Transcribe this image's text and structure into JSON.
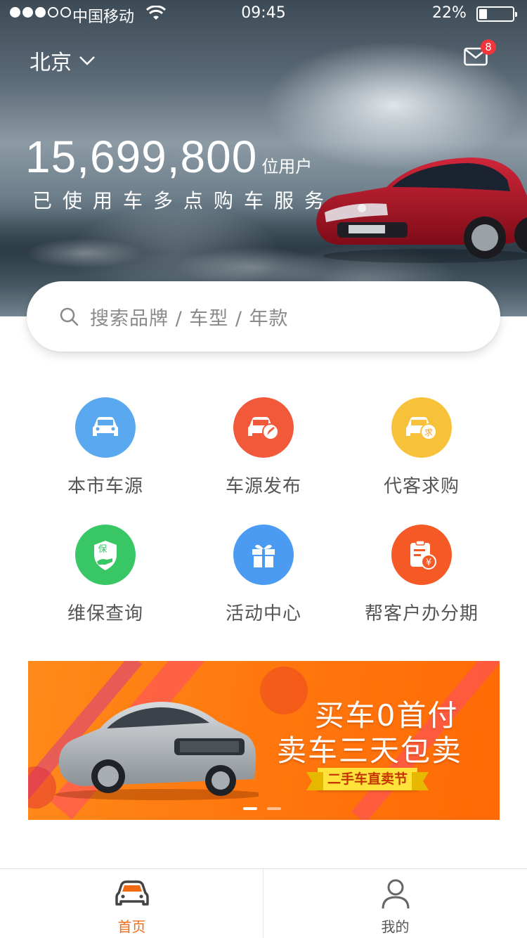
{
  "status_bar": {
    "carrier": "中国移动",
    "time": "09:45",
    "battery": "22%",
    "battery_level": 0.22,
    "signal_bars_filled": 3,
    "signal_bars_total": 5
  },
  "header": {
    "city": "北京",
    "mail_badge": "8"
  },
  "hero": {
    "user_count": "15,699,800",
    "user_unit": "位用户",
    "slogan": "已使用车多点购车服务"
  },
  "search": {
    "placeholder": "搜索品牌 / 车型 / 年款"
  },
  "features": [
    {
      "label": "本市车源",
      "icon": "car-icon",
      "color": "#5aa9f0"
    },
    {
      "label": "车源发布",
      "icon": "car-edit-icon",
      "color": "#f2583a"
    },
    {
      "label": "代客求购",
      "icon": "car-request-icon",
      "color": "#f7c23a"
    },
    {
      "label": "维保查询",
      "icon": "shield-hand-icon",
      "color": "#39c766"
    },
    {
      "label": "活动中心",
      "icon": "gift-icon",
      "color": "#4c9bf2"
    },
    {
      "label": "帮客户办分期",
      "icon": "bill-yen-icon",
      "color": "#f55a26"
    }
  ],
  "banner": {
    "line1": "买车0首付",
    "line2": "卖车三天包卖",
    "ribbon": "二手车直卖节",
    "total_slides": 2,
    "active_slide": 1
  },
  "tabbar": {
    "tabs": [
      {
        "label": "首页",
        "icon": "car-front-icon",
        "active": true
      },
      {
        "label": "我的",
        "icon": "person-icon",
        "active": false
      }
    ]
  },
  "colors": {
    "accent": "#f26a14",
    "badge": "#f2343b"
  }
}
